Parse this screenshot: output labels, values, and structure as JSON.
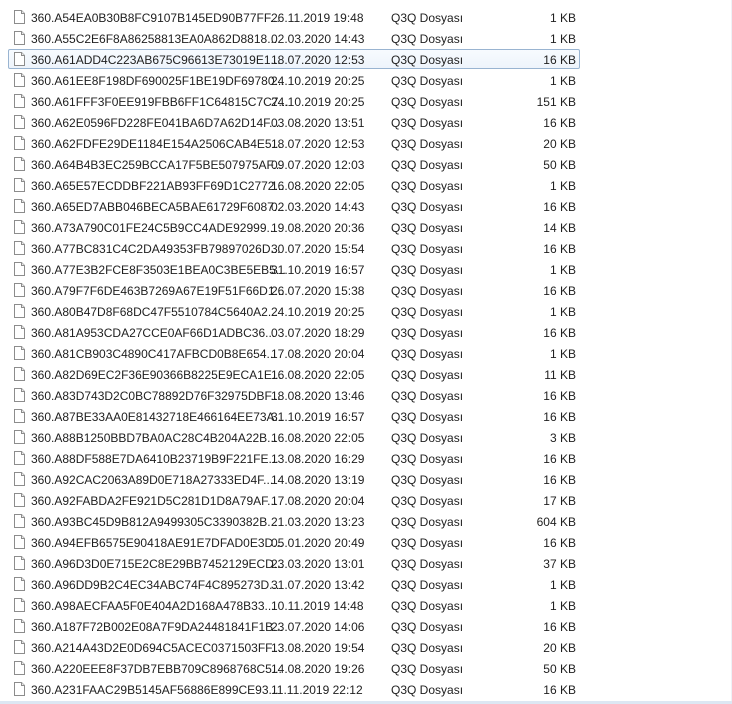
{
  "files": [
    {
      "name": "360.A54EA0B30B8FC9107B145ED90B77FF...",
      "date": "26.11.2019 19:48",
      "type": "Q3Q Dosyası",
      "size": "1 KB",
      "selected": false
    },
    {
      "name": "360.A55C2E6F8A86258813EA0A862D8818...",
      "date": "02.03.2020 14:43",
      "type": "Q3Q Dosyası",
      "size": "1 KB",
      "selected": false
    },
    {
      "name": "360.A61ADD4C223AB675C96613E73019E1...",
      "date": "18.07.2020 12:53",
      "type": "Q3Q Dosyası",
      "size": "16 KB",
      "selected": true
    },
    {
      "name": "360.A61EE8F198DF690025F1BE19DF69780...",
      "date": "24.10.2019 20:25",
      "type": "Q3Q Dosyası",
      "size": "1 KB",
      "selected": false
    },
    {
      "name": "360.A61FFF3F0EE919FBB6FF1C64815C7C7...",
      "date": "24.10.2019 20:25",
      "type": "Q3Q Dosyası",
      "size": "151 KB",
      "selected": false
    },
    {
      "name": "360.A62E0596FD228FE041BA6D7A62D14F...",
      "date": "03.08.2020 13:51",
      "type": "Q3Q Dosyası",
      "size": "16 KB",
      "selected": false
    },
    {
      "name": "360.A62FDFE29DE1184E154A2506CAB4E5...",
      "date": "18.07.2020 12:53",
      "type": "Q3Q Dosyası",
      "size": "20 KB",
      "selected": false
    },
    {
      "name": "360.A64B4B3EC259BCCA17F5BE507975AF...",
      "date": "09.07.2020 12:03",
      "type": "Q3Q Dosyası",
      "size": "50 KB",
      "selected": false
    },
    {
      "name": "360.A65E57ECDDBF221AB93FF69D1C2772...",
      "date": "16.08.2020 22:05",
      "type": "Q3Q Dosyası",
      "size": "1 KB",
      "selected": false
    },
    {
      "name": "360.A65ED7ABB046BECA5BAE61729F6087...",
      "date": "02.03.2020 14:43",
      "type": "Q3Q Dosyası",
      "size": "16 KB",
      "selected": false
    },
    {
      "name": "360.A73A790C01FE24C5B9CC4ADE92999...",
      "date": "19.08.2020 20:36",
      "type": "Q3Q Dosyası",
      "size": "14 KB",
      "selected": false
    },
    {
      "name": "360.A77BC831C4C2DA49353FB79897026D...",
      "date": "30.07.2020 15:54",
      "type": "Q3Q Dosyası",
      "size": "16 KB",
      "selected": false
    },
    {
      "name": "360.A77E3B2FCE8F3503E1BEA0C3BE5EB5...",
      "date": "31.10.2019 16:57",
      "type": "Q3Q Dosyası",
      "size": "1 KB",
      "selected": false
    },
    {
      "name": "360.A79F7F6DE463B7269A67E19F51F66D1...",
      "date": "26.07.2020 15:38",
      "type": "Q3Q Dosyası",
      "size": "16 KB",
      "selected": false
    },
    {
      "name": "360.A80B47D8F68DC47F5510784C5640A2...",
      "date": "24.10.2019 20:25",
      "type": "Q3Q Dosyası",
      "size": "1 KB",
      "selected": false
    },
    {
      "name": "360.A81A953CDA27CCE0AF66D1ADBC36...",
      "date": "03.07.2020 18:29",
      "type": "Q3Q Dosyası",
      "size": "16 KB",
      "selected": false
    },
    {
      "name": "360.A81CB903C4890C417AFBCD0B8E654...",
      "date": "17.08.2020 20:04",
      "type": "Q3Q Dosyası",
      "size": "1 KB",
      "selected": false
    },
    {
      "name": "360.A82D69EC2F36E90366B8225E9ECA1E...",
      "date": "16.08.2020 22:05",
      "type": "Q3Q Dosyası",
      "size": "11 KB",
      "selected": false
    },
    {
      "name": "360.A83D743D2C0BC78892D76F32975DBF...",
      "date": "18.08.2020 13:46",
      "type": "Q3Q Dosyası",
      "size": "16 KB",
      "selected": false
    },
    {
      "name": "360.A87BE33AA0E81432718E466164EE73A...",
      "date": "31.10.2019 16:57",
      "type": "Q3Q Dosyası",
      "size": "16 KB",
      "selected": false
    },
    {
      "name": "360.A88B1250BBD7BA0AC28C4B204A22B...",
      "date": "16.08.2020 22:05",
      "type": "Q3Q Dosyası",
      "size": "3 KB",
      "selected": false
    },
    {
      "name": "360.A88DF588E7DA6410B23719B9F221FE...",
      "date": "13.08.2020 16:29",
      "type": "Q3Q Dosyası",
      "size": "16 KB",
      "selected": false
    },
    {
      "name": "360.A92CAC2063A89D0E718A27333ED4F...",
      "date": "14.08.2020 13:19",
      "type": "Q3Q Dosyası",
      "size": "16 KB",
      "selected": false
    },
    {
      "name": "360.A92FABDA2FE921D5C281D1D8A79AF...",
      "date": "17.08.2020 20:04",
      "type": "Q3Q Dosyası",
      "size": "17 KB",
      "selected": false
    },
    {
      "name": "360.A93BC45D9B812A9499305C3390382B...",
      "date": "21.03.2020 13:23",
      "type": "Q3Q Dosyası",
      "size": "604 KB",
      "selected": false
    },
    {
      "name": "360.A94EFB6575E90418AE91E7DFAD0E3D...",
      "date": "05.01.2020 20:49",
      "type": "Q3Q Dosyası",
      "size": "16 KB",
      "selected": false
    },
    {
      "name": "360.A96D3D0E715E2C8E29BB7452129ECD...",
      "date": "23.03.2020 13:01",
      "type": "Q3Q Dosyası",
      "size": "37 KB",
      "selected": false
    },
    {
      "name": "360.A96DD9B2C4EC34ABC74F4C895273D...",
      "date": "31.07.2020 13:42",
      "type": "Q3Q Dosyası",
      "size": "1 KB",
      "selected": false
    },
    {
      "name": "360.A98AECFAA5F0E404A2D168A478B33...",
      "date": "10.11.2019 14:48",
      "type": "Q3Q Dosyası",
      "size": "1 KB",
      "selected": false
    },
    {
      "name": "360.A187F72B002E08A7F9DA24481841F1B...",
      "date": "23.07.2020 14:06",
      "type": "Q3Q Dosyası",
      "size": "16 KB",
      "selected": false
    },
    {
      "name": "360.A214A43D2E0D694C5ACEC0371503FF...",
      "date": "13.08.2020 19:54",
      "type": "Q3Q Dosyası",
      "size": "20 KB",
      "selected": false
    },
    {
      "name": "360.A220EEE8F37DB7EBB709C8968768C5...",
      "date": "14.08.2020 19:26",
      "type": "Q3Q Dosyası",
      "size": "50 KB",
      "selected": false
    },
    {
      "name": "360.A231FAAC29B5145AF56886E899CE93...",
      "date": "11.11.2019 22:12",
      "type": "Q3Q Dosyası",
      "size": "16 KB",
      "selected": false
    }
  ],
  "colors": {
    "text": "#1e1e1e",
    "selection_border": "#99b4d1",
    "selection_fill": "#eef4fb"
  },
  "icons": {
    "file_icon": "generic-file-icon"
  }
}
